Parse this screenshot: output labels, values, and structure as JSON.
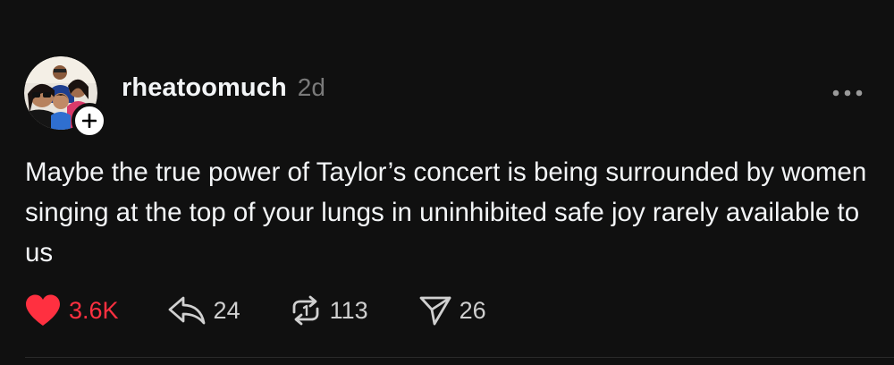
{
  "post": {
    "author": {
      "username": "rheatoomuch",
      "time_ago": "2d",
      "avatar_icon": "profile-photo",
      "follow_icon": "plus-icon"
    },
    "text": "Maybe the true power of Taylor’s concert is being surrounded by women singing at the top of your lungs in uninhibited safe joy rarely available to us",
    "actions": {
      "like": {
        "icon": "heart-filled-icon",
        "count": "3.6K",
        "liked": true,
        "color": "#ff3040"
      },
      "reply": {
        "icon": "reply-icon",
        "count": "24"
      },
      "repost": {
        "icon": "repost-icon",
        "count": "113"
      },
      "share": {
        "icon": "send-icon",
        "count": "26"
      }
    },
    "more_icon": "more-options-icon"
  }
}
